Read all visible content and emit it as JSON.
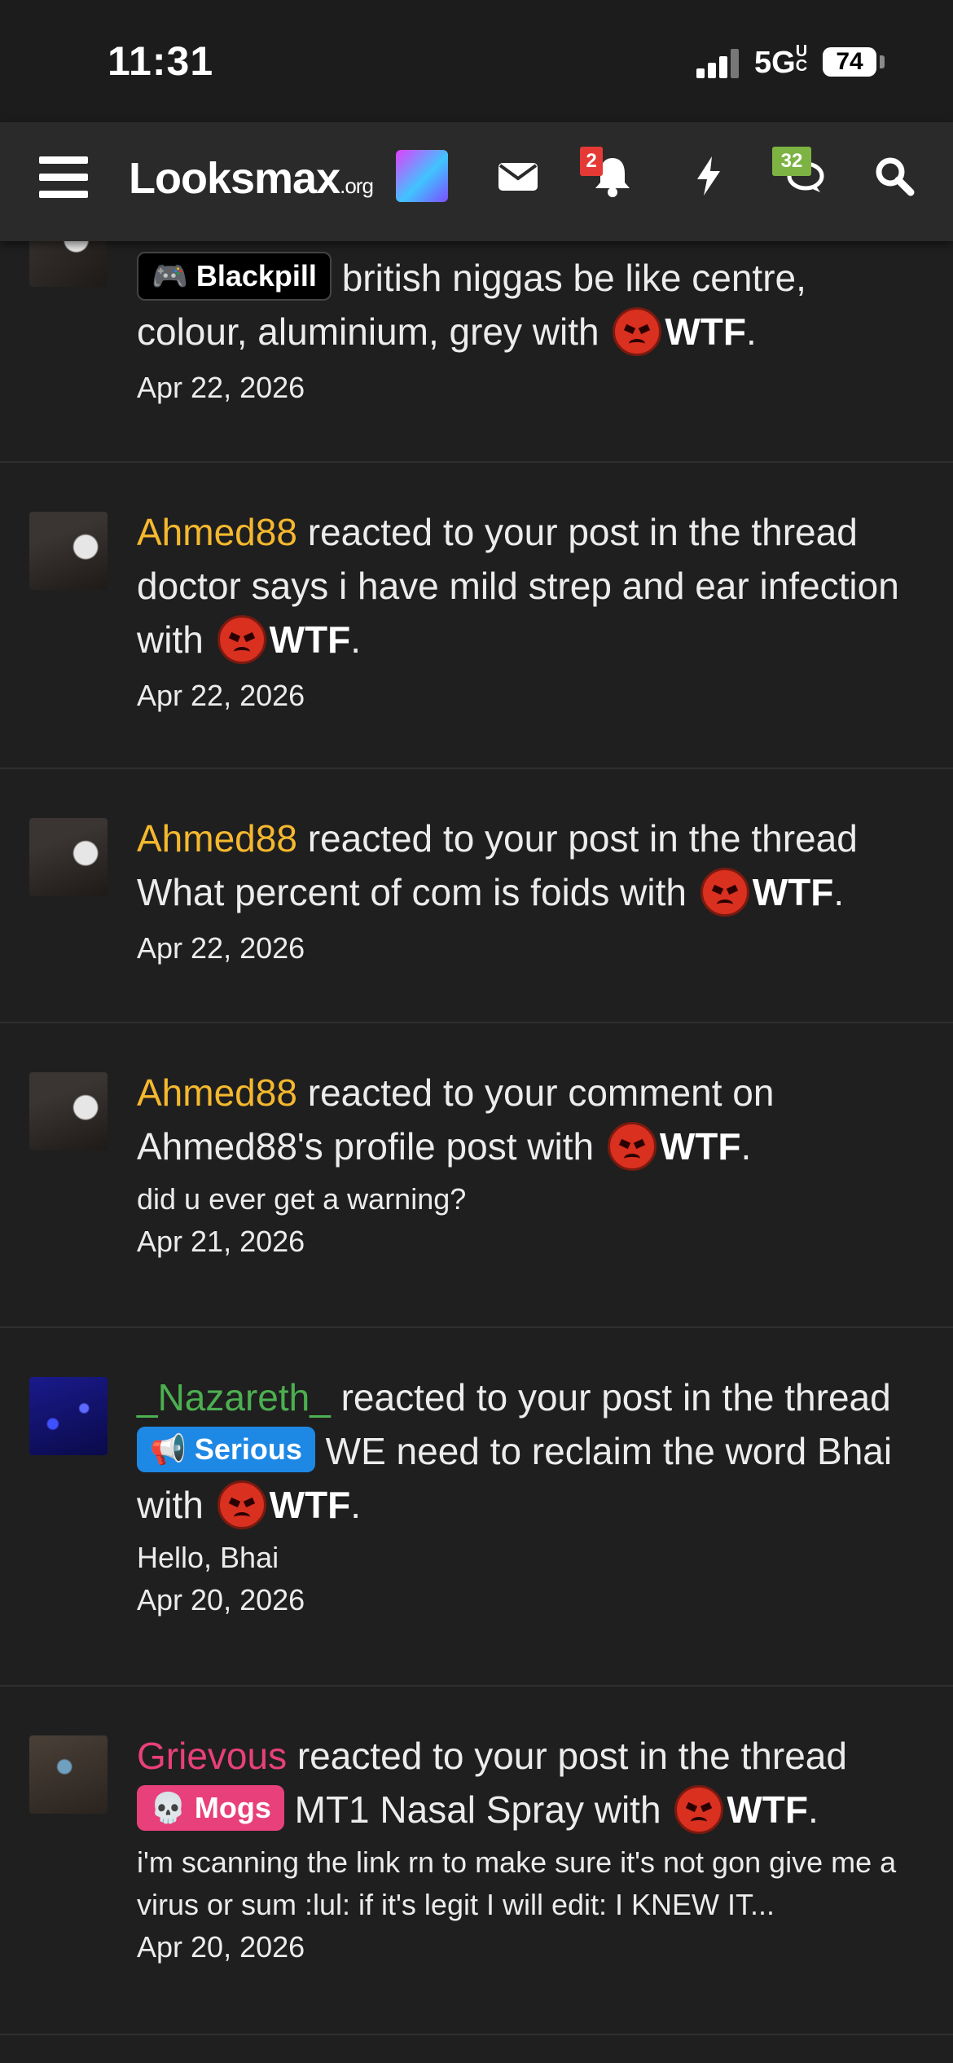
{
  "status": {
    "time": "11:31",
    "network": "5G",
    "network_suffix": "UC",
    "battery": "74"
  },
  "nav": {
    "logo_main": "Looksmax",
    "logo_suffix": ".org",
    "alerts_badge": "2",
    "conversations_badge": "32"
  },
  "colors": {
    "accent_orange": "#f5b82e",
    "accent_green": "#4caf50",
    "accent_pink": "#e8407a",
    "badge_red": "#e53935",
    "badge_green": "#7cb342"
  },
  "items": [
    {
      "prefix": "Blackpill",
      "title": "british niggas be like centre, colour, aluminium, grey with",
      "reaction": "WTF",
      "date": "Apr 22, 2026"
    },
    {
      "user": "Ahmed88",
      "action": "reacted to your post in the thread doctor says i have mild strep and ear infection with",
      "reaction": "WTF",
      "date": "Apr 22, 2026"
    },
    {
      "user": "Ahmed88",
      "action": "reacted to your post in the thread What percent of com is foids with",
      "reaction": "WTF",
      "date": "Apr 22, 2026"
    },
    {
      "user": "Ahmed88",
      "action": "reacted to your comment on Ahmed88's profile post with",
      "reaction": "WTF",
      "snippet": "did u ever get a warning?",
      "date": "Apr 21, 2026"
    },
    {
      "user": "_Nazareth_",
      "action_pre": "reacted to your post in the thread",
      "prefix": "Serious",
      "action_post": "WE need to reclaim the word Bhai with",
      "reaction": "WTF",
      "snippet": "Hello, Bhai",
      "date": "Apr 20, 2026"
    },
    {
      "user": "Grievous",
      "action_pre": "reacted to your post in the thread",
      "prefix": "Mogs",
      "action_post": "MT1 Nasal Spray with",
      "reaction": "WTF",
      "snippet": "i'm scanning the link rn to make sure it's not gon give me a virus or sum :lul: if it's legit I will edit: I KNEW IT...",
      "date": "Apr 20, 2026"
    }
  ]
}
